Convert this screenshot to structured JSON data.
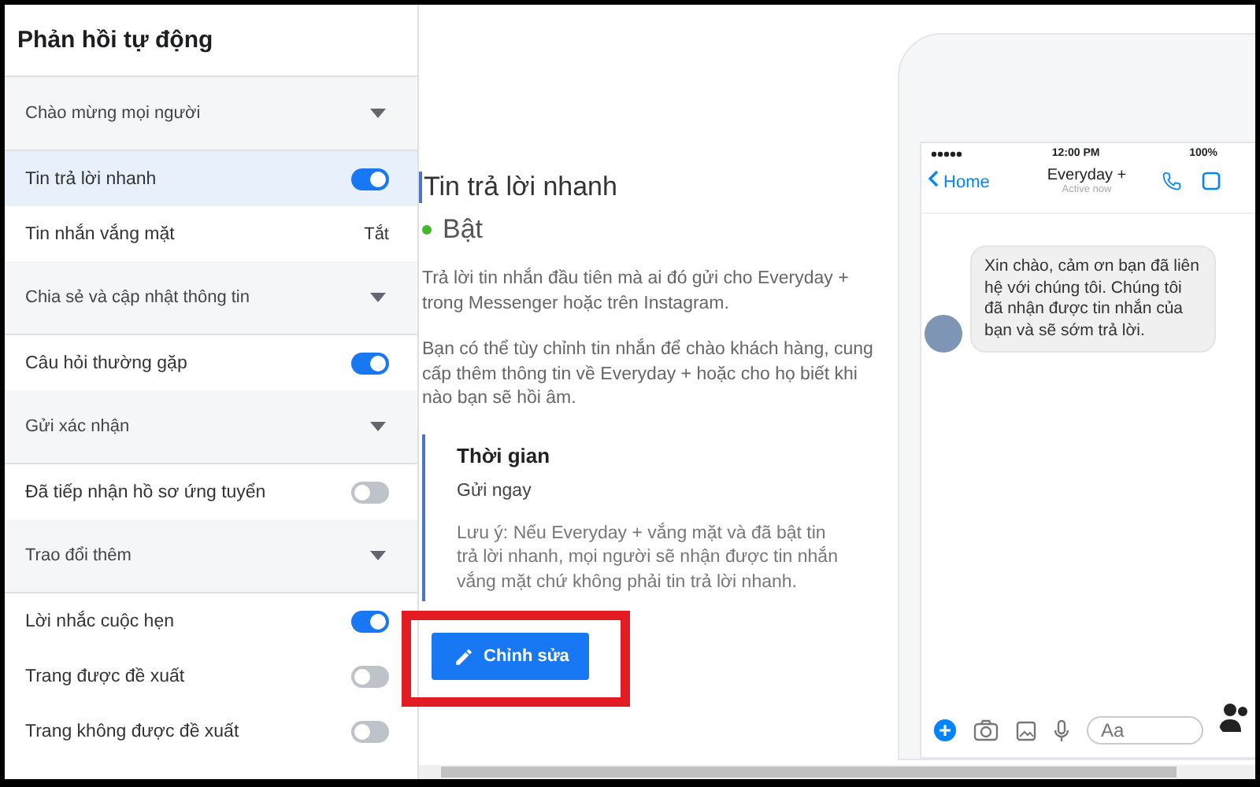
{
  "sidebar": {
    "title": "Phản hồi tự động",
    "items": [
      {
        "kind": "section",
        "label": "Chào mừng mọi người"
      },
      {
        "kind": "toggle",
        "label": "Tin trả lời nhanh",
        "on": true,
        "selected": true
      },
      {
        "kind": "text",
        "label": "Tin nhắn vắng mặt",
        "value": "Tắt",
        "selected": false
      },
      {
        "kind": "section",
        "label": "Chia sẻ và cập nhật thông tin"
      },
      {
        "kind": "toggle",
        "label": "Câu hỏi thường gặp",
        "on": true,
        "selected": false
      },
      {
        "kind": "section",
        "label": "Gửi xác nhận"
      },
      {
        "kind": "toggle",
        "label": "Đã tiếp nhận hồ sơ ứng tuyển",
        "on": false,
        "selected": false
      },
      {
        "kind": "section",
        "label": "Trao đổi thêm"
      },
      {
        "kind": "toggle",
        "label": "Lời nhắc cuộc hẹn",
        "on": true,
        "selected": false
      },
      {
        "kind": "toggle",
        "label": "Trang được đề xuất",
        "on": false,
        "selected": false
      },
      {
        "kind": "toggle",
        "label": "Trang không được đề xuất",
        "on": false,
        "selected": false
      }
    ]
  },
  "detail": {
    "title": "Tin trả lời nhanh",
    "status": {
      "label": "Bật",
      "on": true
    },
    "paragraphs": [
      "Trả lời tin nhắn đầu tiên mà ai đó gửi cho Everyday + trong Messenger hoặc trên Instagram.",
      "Bạn có thể tùy chỉnh tin nhắn để chào khách hàng, cung cấp thêm thông tin về Everyday + hoặc cho họ biết khi nào bạn sẽ hồi âm."
    ],
    "setting": {
      "heading": "Thời gian",
      "value": "Gửi ngay",
      "note": "Lưu ý: Nếu Everyday + vắng mặt và đã bật tin trả lời nhanh, mọi người sẽ nhận được tin nhắn vắng mặt chứ không phải tin trả lời nhanh."
    },
    "edit_button": {
      "label": "Chỉnh sửa",
      "highlighted": true
    }
  },
  "preview": {
    "status_bar": {
      "time": "12:00 PM",
      "battery": "100%"
    },
    "back": "Home",
    "contact": "Everyday +",
    "presence": "Active now",
    "message": "Xin chào, cảm ơn bạn đã liên hệ với chúng tôi. Chúng tôi đã nhận được tin nhắn của bạn và sẽ sớm trả lời.",
    "composer": {
      "placeholder": "Aa"
    }
  }
}
